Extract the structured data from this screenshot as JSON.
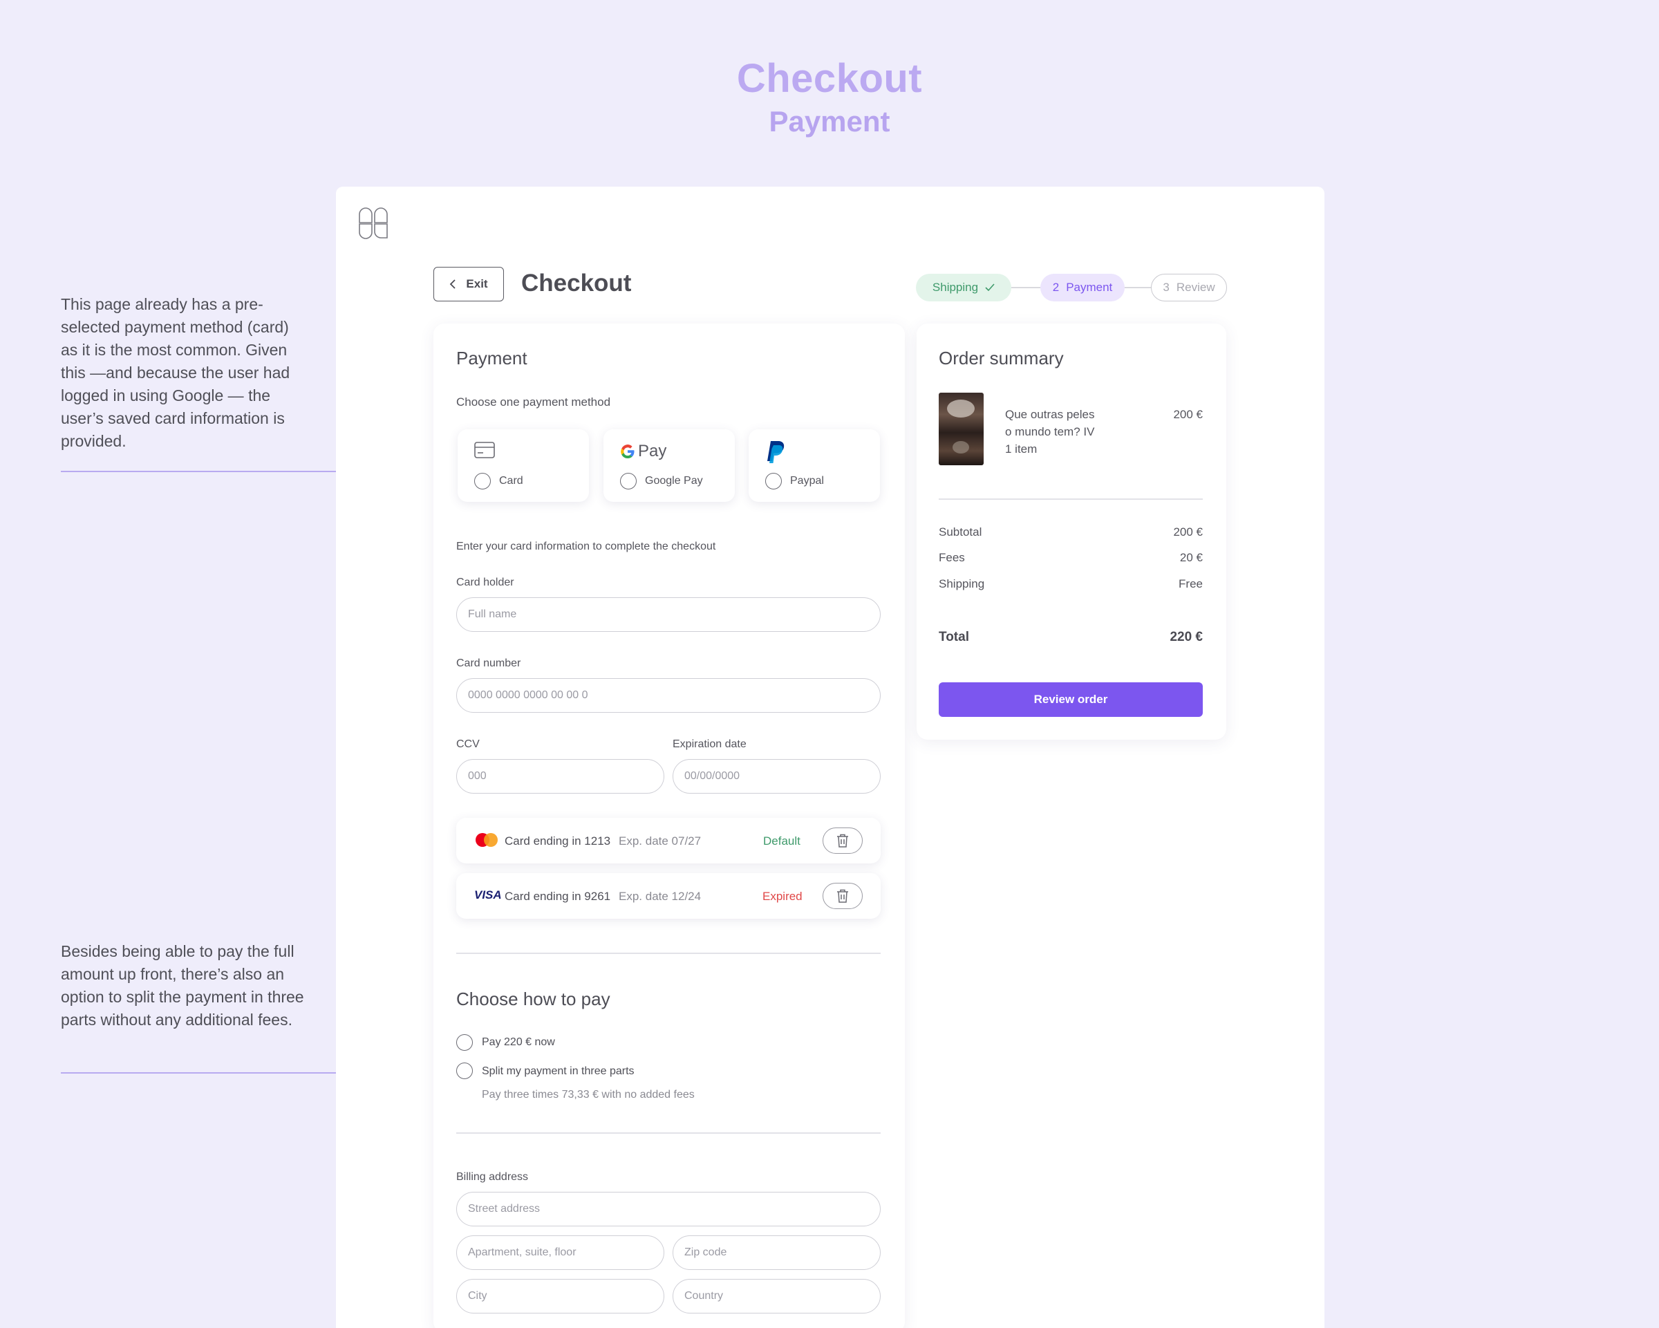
{
  "header": {
    "title": "Checkout",
    "subtitle": "Payment"
  },
  "annotations": [
    "This page already has a pre-selected payment method (card) as it is the most common. Given this —and because the user had logged in using Google — the user’s saved card information is provided.",
    "Besides being able to pay the full amount up front, there’s also an option to split the payment in three parts without any additional fees."
  ],
  "topbar": {
    "exit_label": "Exit",
    "page_title": "Checkout"
  },
  "stepper": {
    "steps": [
      {
        "label": "Shipping",
        "prefix": "",
        "state": "done"
      },
      {
        "label": "Payment",
        "prefix": "2",
        "state": "active"
      },
      {
        "label": "Review",
        "prefix": "3",
        "state": "upcoming"
      }
    ]
  },
  "payment": {
    "title": "Payment",
    "method_prompt": "Choose one payment method",
    "methods": [
      {
        "label": "Card",
        "icon": "credit-card-icon"
      },
      {
        "label": "Google Pay",
        "icon": "google-pay-icon"
      },
      {
        "label": "Paypal",
        "icon": "paypal-icon"
      }
    ],
    "google_pay_text": "Pay",
    "card_prompt": "Enter  your card information to complete the checkout",
    "card_holder_label": "Card holder",
    "card_holder_placeholder": "Full name",
    "card_number_label": "Card number",
    "card_number_placeholder": "0000 0000 0000 00 00 0",
    "ccv_label": "CCV",
    "ccv_placeholder": "000",
    "expiration_label": "Expiration date",
    "expiration_placeholder": "00/00/0000",
    "saved_cards": [
      {
        "brand": "mastercard-icon",
        "ending": "Card ending in 1213",
        "exp": "Exp. date 07/27",
        "status": "Default",
        "status_color": "#3f9a6b"
      },
      {
        "brand": "visa-icon",
        "brand_text": "VISA",
        "ending": "Card ending in 9261",
        "exp": "Exp. date 12/24",
        "status": "Expired",
        "status_color": "#e04848"
      }
    ]
  },
  "how_to_pay": {
    "title": "Choose how to pay",
    "options": [
      {
        "label": "Pay 220 € now"
      },
      {
        "label": "Split my payment in three parts"
      }
    ],
    "split_note": "Pay three times 73,33 € with no added fees"
  },
  "billing": {
    "label": "Billing address",
    "street_placeholder": "Street address",
    "apartment_placeholder": "Apartment, suite, floor",
    "zip_placeholder": "Zip code",
    "city_placeholder": "City",
    "country_placeholder": "Country"
  },
  "order_summary": {
    "title": "Order summary",
    "item": {
      "name_line1": "Que outras peles",
      "name_line2": "o mundo tem? IV",
      "quantity": "1 item",
      "price": "200 €"
    },
    "rows": [
      {
        "label": "Subtotal",
        "value": "200 €"
      },
      {
        "label": "Fees",
        "value": "20 €"
      },
      {
        "label": "Shipping",
        "value": "Free"
      }
    ],
    "total_label": "Total",
    "total_value": "220 €",
    "review_button": "Review order"
  },
  "colors": {
    "accent": "#7c56ef",
    "background": "#efedfb",
    "hero": "#bba9f1",
    "done_step_bg": "#e3f4ea",
    "done_step_text": "#3f9a6b",
    "active_step_bg": "#ece5fd",
    "active_step_text": "#7c56ef"
  }
}
